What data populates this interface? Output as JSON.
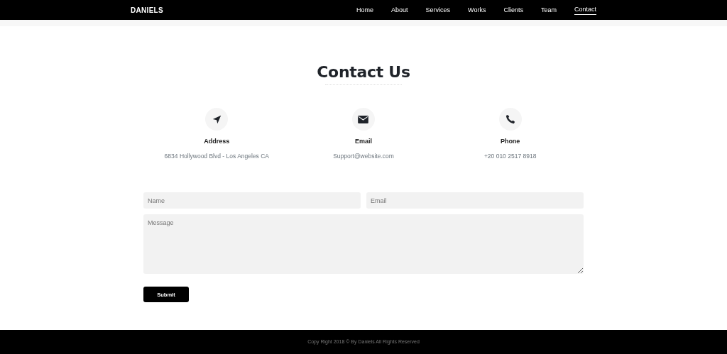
{
  "navbar": {
    "brand": "DANIELS",
    "links": [
      {
        "label": "Home",
        "selected": false
      },
      {
        "label": "About",
        "selected": false
      },
      {
        "label": "Services",
        "selected": false
      },
      {
        "label": "Works",
        "selected": false
      },
      {
        "label": "Clients",
        "selected": false
      },
      {
        "label": "Team",
        "selected": false
      },
      {
        "label": "Contact",
        "selected": true
      }
    ]
  },
  "heading": "Contact Us",
  "contacts": [
    {
      "kind": "location",
      "title": "Address",
      "value": "6834 Hollywood Blvd - Los Angeles CA"
    },
    {
      "kind": "email",
      "title": "Email",
      "value": "Support@website.com"
    },
    {
      "kind": "phone",
      "title": "Phone",
      "value": "+20 010 2517 8918"
    }
  ],
  "form": {
    "name": {
      "placeholder": "Name"
    },
    "email": {
      "placeholder": "Email"
    },
    "message": {
      "placeholder": "Message"
    },
    "submit": "Submit"
  },
  "footer": "Copy Right 2018 © By Daniels All Rights Reserved"
}
